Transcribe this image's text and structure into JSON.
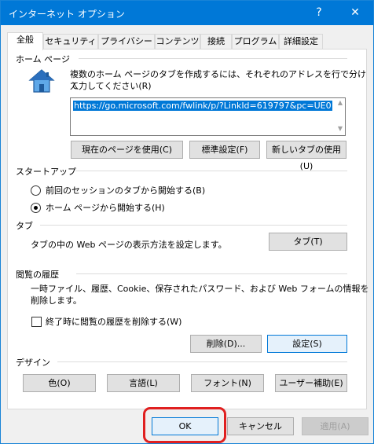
{
  "window": {
    "title": "インターネット オプション",
    "help_label": "?",
    "close_label": "✕"
  },
  "tabs": [
    {
      "label": "全般"
    },
    {
      "label": "セキュリティ"
    },
    {
      "label": "プライバシー"
    },
    {
      "label": "コンテンツ"
    },
    {
      "label": "接続"
    },
    {
      "label": "プログラム"
    },
    {
      "label": "詳細設定"
    }
  ],
  "home": {
    "group_title": "ホーム ページ",
    "description_line1": "複数のホーム ページのタブを作成するには、それぞれのアドレスを行で分けて",
    "description_line2": "入力してください(R)",
    "url_value": "https://go.microsoft.com/fwlink/p/?LinkId=619797&pc=UE0",
    "use_current_label": "現在のページを使用(C)",
    "use_default_label": "標準設定(F)",
    "use_new_tab_label": "新しいタブの使用(U)",
    "icon": "house-icon"
  },
  "startup": {
    "group_title": "スタートアップ",
    "option1": "前回のセッションのタブから開始する(B)",
    "option2": "ホーム ページから開始する(H)",
    "selected": "option2"
  },
  "tabs_group": {
    "group_title": "タブ",
    "description": "タブの中の Web ページの表示方法を設定します。",
    "button_label": "タブ(T)"
  },
  "history": {
    "group_title": "閲覧の履歴",
    "description_line1": "一時ファイル、履歴、Cookie、保存されたパスワード、および Web フォームの情報を",
    "description_line2": "削除します。",
    "checkbox_label": "終了時に閲覧の履歴を削除する(W)",
    "checked": false,
    "delete_label": "削除(D)...",
    "settings_label": "設定(S)"
  },
  "design": {
    "group_title": "デザイン",
    "colors_label": "色(O)",
    "languages_label": "言語(L)",
    "fonts_label": "フォント(N)",
    "accessibility_label": "ユーザー補助(E)"
  },
  "footer": {
    "ok_label": "OK",
    "cancel_label": "キャンセル",
    "apply_label": "適用(A)"
  },
  "colors": {
    "titlebar": "#0078d7",
    "highlight": "#e02020"
  }
}
